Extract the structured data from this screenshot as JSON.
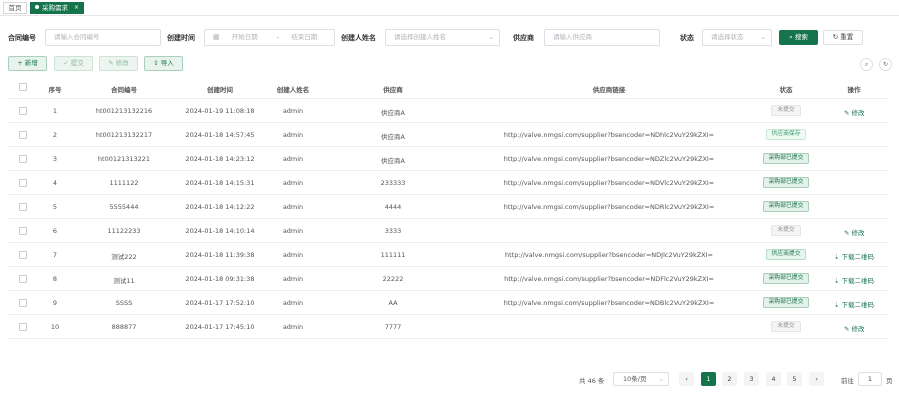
{
  "tabs": {
    "home": "首页",
    "active": "采购需求",
    "close": "×"
  },
  "filters": {
    "contract_label": "合同编号",
    "contract_placeholder": "请输入合同编号",
    "created_label": "创建时间",
    "start_placeholder": "开始日期",
    "range_sep": "-",
    "end_placeholder": "结束日期",
    "creator_label": "创建人姓名",
    "creator_placeholder": "请选择创建人姓名",
    "supplier_label": "供应商",
    "supplier_placeholder": "请输入供应商",
    "status_label": "状态",
    "status_placeholder": "请选择状态",
    "search_label": "搜索",
    "reset_label": "重置"
  },
  "toolbar": {
    "add": "+ 新增",
    "submit": "✓ 提交",
    "edit": "✎ 修改",
    "import": "⇪ 导入"
  },
  "columns": [
    "序号",
    "合同编号",
    "创建时间",
    "创建人姓名",
    "供应商",
    "供应商链接",
    "状态",
    "操作"
  ],
  "rows": [
    {
      "no": "1",
      "contract": "ht001213132216",
      "time": "2024-01-19 11:08:18",
      "creator": "admin",
      "supplier": "供应商A",
      "link": "",
      "status": "未提交",
      "status_type": "gray",
      "op": "✎ 修改"
    },
    {
      "no": "2",
      "contract": "ht001213132217",
      "time": "2024-01-18 14:57:45",
      "creator": "admin",
      "supplier": "供应商A",
      "link": "http://valve.nmgsi.com/supplier?bsencoder=NDhlc2VuY29kZXI=",
      "status": "供应商保存",
      "status_type": "light",
      "op": ""
    },
    {
      "no": "3",
      "contract": "ht00121313221",
      "time": "2024-01-18 14:23:12",
      "creator": "admin",
      "supplier": "供应商A",
      "link": "http://valve.nmgsi.com/supplier?bsencoder=NDZlc2VuY29kZXI=",
      "status": "采购部已提交",
      "status_type": "mid",
      "op": ""
    },
    {
      "no": "4",
      "contract": "1111122",
      "time": "2024-01-18 14:15:31",
      "creator": "admin",
      "supplier": "233333",
      "link": "http://valve.nmgsi.com/supplier?bsencoder=NDVlc2VuY29kZXI=",
      "status": "采购部已提交",
      "status_type": "mid",
      "op": ""
    },
    {
      "no": "5",
      "contract": "5555444",
      "time": "2024-01-18 14:12:22",
      "creator": "admin",
      "supplier": "4444",
      "link": "http://valve.nmgsi.com/supplier?bsencoder=NDRlc2VuY29kZXI=",
      "status": "采购部已提交",
      "status_type": "mid",
      "op": ""
    },
    {
      "no": "6",
      "contract": "11122233",
      "time": "2024-01-18 14:10:14",
      "creator": "admin",
      "supplier": "3333",
      "link": "",
      "status": "未提交",
      "status_type": "gray",
      "op": "✎ 修改"
    },
    {
      "no": "7",
      "contract": "测试222",
      "time": "2024-01-18 11:39:38",
      "creator": "admin",
      "supplier": "111111",
      "link": "http://valve.nmgsi.com/supplier?bsencoder=NDJlc2VuY29kZXI=",
      "status": "供应商提交",
      "status_type": "green",
      "op": "⇣ 下载二维码"
    },
    {
      "no": "8",
      "contract": "测试11",
      "time": "2024-01-18 09:31:38",
      "creator": "admin",
      "supplier": "22222",
      "link": "http://valve.nmgsi.com/supplier?bsencoder=NDFlc2VuY29kZXI=",
      "status": "采购部已提交",
      "status_type": "mid",
      "op": "⇣ 下载二维码"
    },
    {
      "no": "9",
      "contract": "SSSS",
      "time": "2024-01-17 17:52:10",
      "creator": "admin",
      "supplier": "AA",
      "link": "http://valve.nmgsi.com/supplier?bsencoder=NDBlc2VuY29kZXI=",
      "status": "采购部已提交",
      "status_type": "mid",
      "op": "⇣ 下载二维码"
    },
    {
      "no": "10",
      "contract": "888877",
      "time": "2024-01-17 17:45:10",
      "creator": "admin",
      "supplier": "7777",
      "link": "",
      "status": "未提交",
      "status_type": "gray",
      "op": "✎ 修改"
    }
  ],
  "pagination": {
    "total": "共 46 条",
    "page_size": "10条/页",
    "prev": "‹",
    "pages": [
      "1",
      "2",
      "3",
      "4",
      "5"
    ],
    "next": "›",
    "goto_label": "前往",
    "goto_value": "1",
    "page_unit": "页"
  }
}
